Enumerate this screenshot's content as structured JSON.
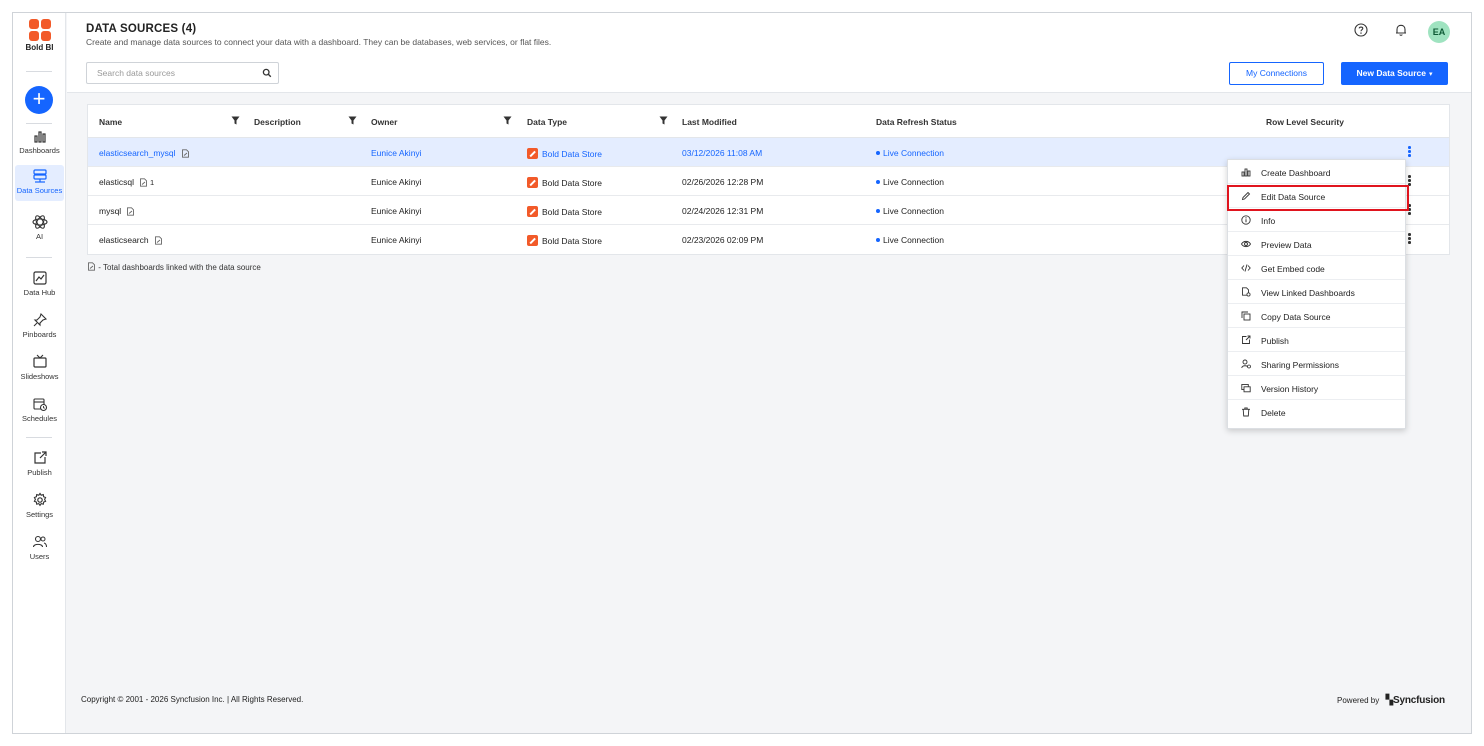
{
  "app": {
    "name": "Bold BI"
  },
  "sidebar": {
    "items": [
      {
        "label": "Dashboards",
        "icon": "bar-chart-icon",
        "active": false
      },
      {
        "label": "Data Sources",
        "icon": "database-icon",
        "active": true
      },
      {
        "label": "AI",
        "icon": "atom-icon",
        "active": false
      },
      {
        "label": "Data Hub",
        "icon": "data-hub-icon",
        "active": false
      },
      {
        "label": "Pinboards",
        "icon": "pin-icon",
        "active": false
      },
      {
        "label": "Slideshows",
        "icon": "tv-icon",
        "active": false
      },
      {
        "label": "Schedules",
        "icon": "calendar-clock-icon",
        "active": false
      },
      {
        "label": "Publish",
        "icon": "publish-icon",
        "active": false
      },
      {
        "label": "Settings",
        "icon": "gear-icon",
        "active": false
      },
      {
        "label": "Users",
        "icon": "users-icon",
        "active": false
      }
    ]
  },
  "header": {
    "title": "DATA SOURCES (4)",
    "subtitle": "Create and manage data sources to connect your data with a dashboard. They can be databases, web services, or flat files.",
    "search_placeholder": "Search data sources",
    "my_connections_label": "My Connections",
    "new_data_source_label": "New Data Source",
    "avatar_initials": "EA",
    "accent_color": "#1565ff"
  },
  "table": {
    "columns": [
      "Name",
      "Description",
      "Owner",
      "Data Type",
      "Last Modified",
      "Data Refresh Status",
      "Row Level Security"
    ],
    "rows": [
      {
        "name": "elasticsearch_mysql",
        "linked_count": "",
        "description": "",
        "owner": "Eunice Akinyi",
        "data_type": "Bold Data Store",
        "last_modified": "03/12/2026 11:08 AM",
        "refresh_status": "Live Connection",
        "selected": true
      },
      {
        "name": "elasticsql",
        "linked_count": "1",
        "description": "",
        "owner": "Eunice Akinyi",
        "data_type": "Bold Data Store",
        "last_modified": "02/26/2026 12:28 PM",
        "refresh_status": "Live Connection",
        "selected": false
      },
      {
        "name": "mysql",
        "linked_count": "",
        "description": "",
        "owner": "Eunice Akinyi",
        "data_type": "Bold Data Store",
        "last_modified": "02/24/2026 12:31 PM",
        "refresh_status": "Live Connection",
        "selected": false
      },
      {
        "name": "elasticsearch",
        "linked_count": "",
        "description": "",
        "owner": "Eunice Akinyi",
        "data_type": "Bold Data Store",
        "last_modified": "02/23/2026 02:09 PM",
        "refresh_status": "Live Connection",
        "selected": false
      }
    ],
    "legend": "- Total dashboards linked with the data source"
  },
  "context_menu": {
    "items": [
      {
        "label": "Create Dashboard",
        "icon": "bar-chart-icon"
      },
      {
        "label": "Edit Data Source",
        "icon": "pencil-icon",
        "highlighted": true
      },
      {
        "label": "Info",
        "icon": "info-icon"
      },
      {
        "label": "Preview Data",
        "icon": "eye-icon"
      },
      {
        "label": "Get Embed code",
        "icon": "code-icon"
      },
      {
        "label": "View Linked Dashboards",
        "icon": "linked-dashboards-icon"
      },
      {
        "label": "Copy Data Source",
        "icon": "copy-icon"
      },
      {
        "label": "Publish",
        "icon": "publish-icon"
      },
      {
        "label": "Sharing Permissions",
        "icon": "share-user-icon"
      },
      {
        "label": "Version History",
        "icon": "version-history-icon"
      },
      {
        "label": "Delete",
        "icon": "trash-icon"
      }
    ],
    "highlight_color": "#e0141e"
  },
  "footer": {
    "copyright": "Copyright © 2001 - 2026 Syncfusion Inc. | All Rights Reserved.",
    "powered_by": "Powered by",
    "brand": "Syncfusion"
  }
}
